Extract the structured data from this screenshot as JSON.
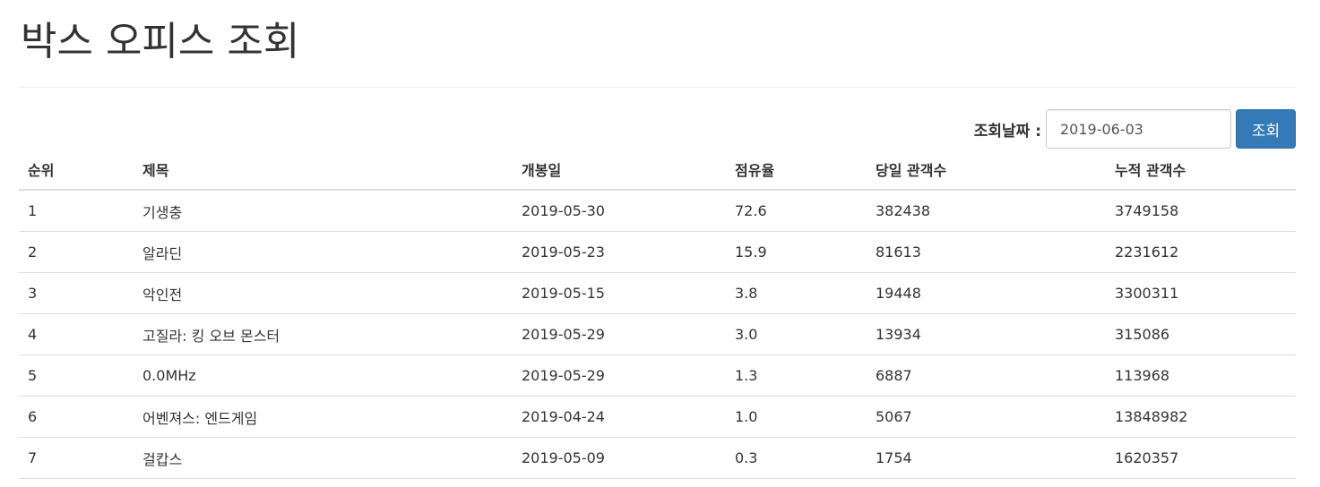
{
  "header": {
    "title": "박스 오피스 조회"
  },
  "search": {
    "label": "조회날짜 :",
    "date_value": "2019-06-03",
    "button_label": "조회"
  },
  "table": {
    "columns": [
      "순위",
      "제목",
      "개봉일",
      "점유율",
      "당일 관객수",
      "누적 관객수"
    ],
    "rows": [
      [
        "1",
        "기생충",
        "2019-05-30",
        "72.6",
        "382438",
        "3749158"
      ],
      [
        "2",
        "알라딘",
        "2019-05-23",
        "15.9",
        "81613",
        "2231612"
      ],
      [
        "3",
        "악인전",
        "2019-05-15",
        "3.8",
        "19448",
        "3300311"
      ],
      [
        "4",
        "고질라: 킹 오브 몬스터",
        "2019-05-29",
        "3.0",
        "13934",
        "315086"
      ],
      [
        "5",
        "0.0MHz",
        "2019-05-29",
        "1.3",
        "6887",
        "113968"
      ],
      [
        "6",
        "어벤져스: 엔드게임",
        "2019-04-24",
        "1.0",
        "5067",
        "13848982"
      ],
      [
        "7",
        "걸캅스",
        "2019-05-09",
        "0.3",
        "1754",
        "1620357"
      ]
    ]
  },
  "colors": {
    "primary_button": "#337ab7",
    "text": "#333333",
    "border": "#dddddd"
  }
}
